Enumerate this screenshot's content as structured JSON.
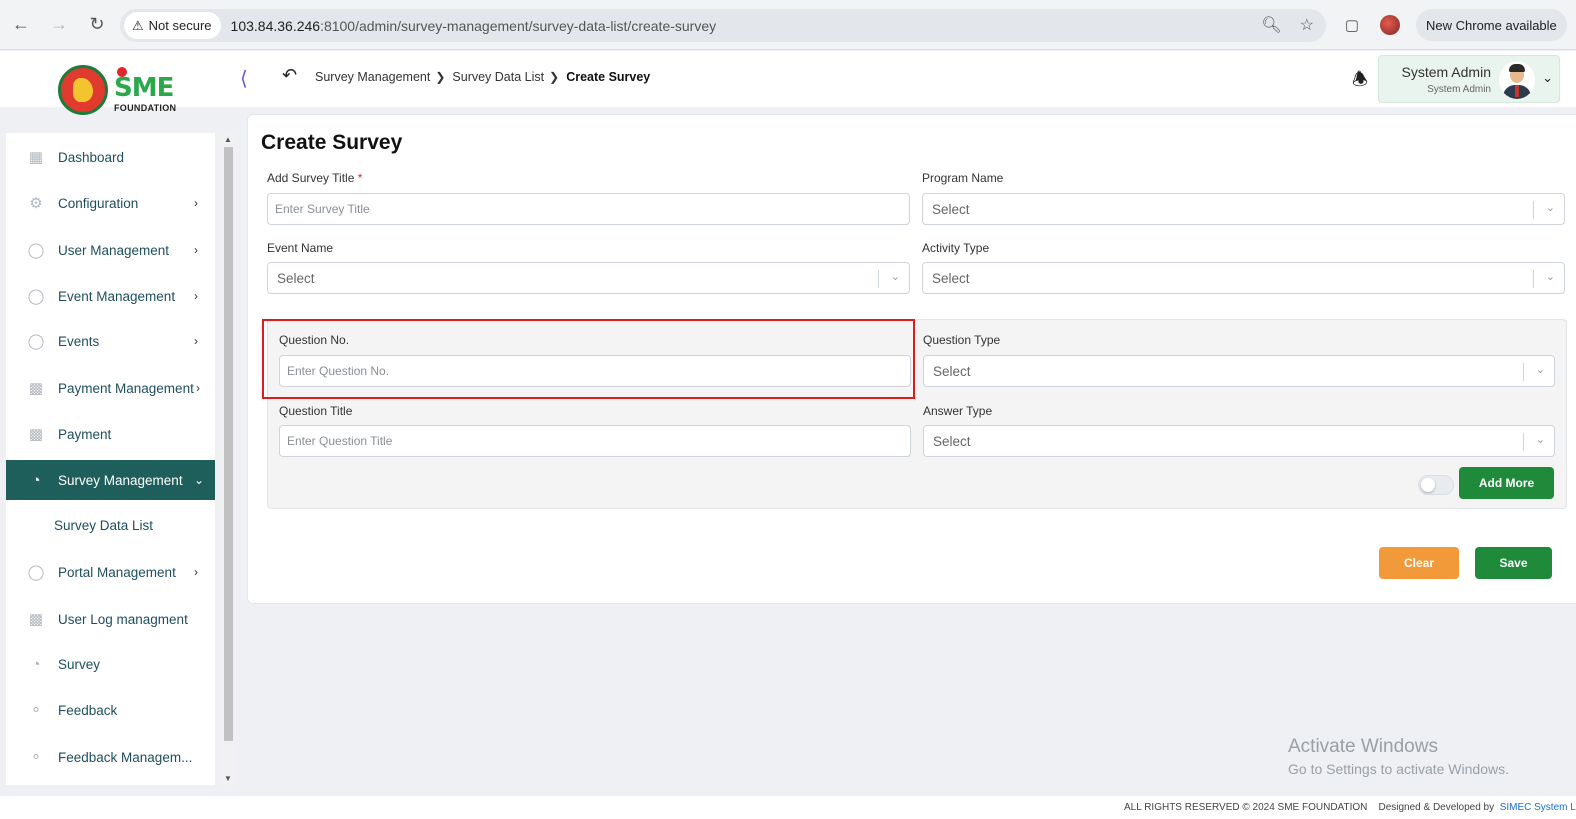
{
  "browser": {
    "security_label": "Not secure",
    "url_host": "103.84.36.246",
    "url_path": ":8100/admin/survey-management/survey-data-list/create-survey",
    "new_chrome_label": "New Chrome available"
  },
  "header": {
    "logo_text": "SME",
    "logo_subtext": "FOUNDATION",
    "breadcrumb": [
      "Survey Management",
      "Survey Data List",
      "Create Survey"
    ],
    "user_name": "System Admin",
    "user_role": "System Admin"
  },
  "sidebar": {
    "items": [
      {
        "label": "Dashboard",
        "icon": "grid-icon"
      },
      {
        "label": "Configuration",
        "icon": "config-icon"
      },
      {
        "label": "User Management",
        "icon": "shield-icon"
      },
      {
        "label": "Event Management",
        "icon": "lock-icon"
      },
      {
        "label": "Events",
        "icon": "lock-icon"
      },
      {
        "label": "Payment Management",
        "icon": "money-icon"
      },
      {
        "label": "Payment",
        "icon": "money-icon"
      },
      {
        "label": "Survey Management",
        "icon": "pie-icon"
      },
      {
        "label": "Portal Management",
        "icon": "lock-icon"
      },
      {
        "label": "User Log managment",
        "icon": "money-icon"
      },
      {
        "label": "Survey",
        "icon": "pie-icon"
      },
      {
        "label": "Feedback",
        "icon": "feedback-icon"
      },
      {
        "label": "Feedback Managem...",
        "icon": "feedback-icon"
      }
    ],
    "sub_item": "Survey Data List"
  },
  "form": {
    "title": "Create Survey",
    "survey_title_label": "Add Survey Title",
    "required_mark": "*",
    "survey_title_placeholder": "Enter Survey Title",
    "program_name_label": "Program Name",
    "program_name_value": "Select",
    "event_name_label": "Event Name",
    "event_name_value": "Select",
    "activity_type_label": "Activity Type",
    "activity_type_value": "Select",
    "question_no_label": "Question No.",
    "question_no_placeholder": "Enter Question No.",
    "question_type_label": "Question Type",
    "question_type_value": "Select",
    "question_title_label": "Question Title",
    "question_title_placeholder": "Enter Question Title",
    "answer_type_label": "Answer Type",
    "answer_type_value": "Select",
    "add_more_label": "Add More",
    "clear_label": "Clear",
    "save_label": "Save"
  },
  "watermark": {
    "line1": "Activate Windows",
    "line2": "Go to Settings to activate Windows."
  },
  "footer": {
    "rights": "ALL RIGHTS RESERVED © 2024 SME FOUNDATION",
    "designed": "Designed & Developed by",
    "company": "SIMEC System Lt"
  }
}
